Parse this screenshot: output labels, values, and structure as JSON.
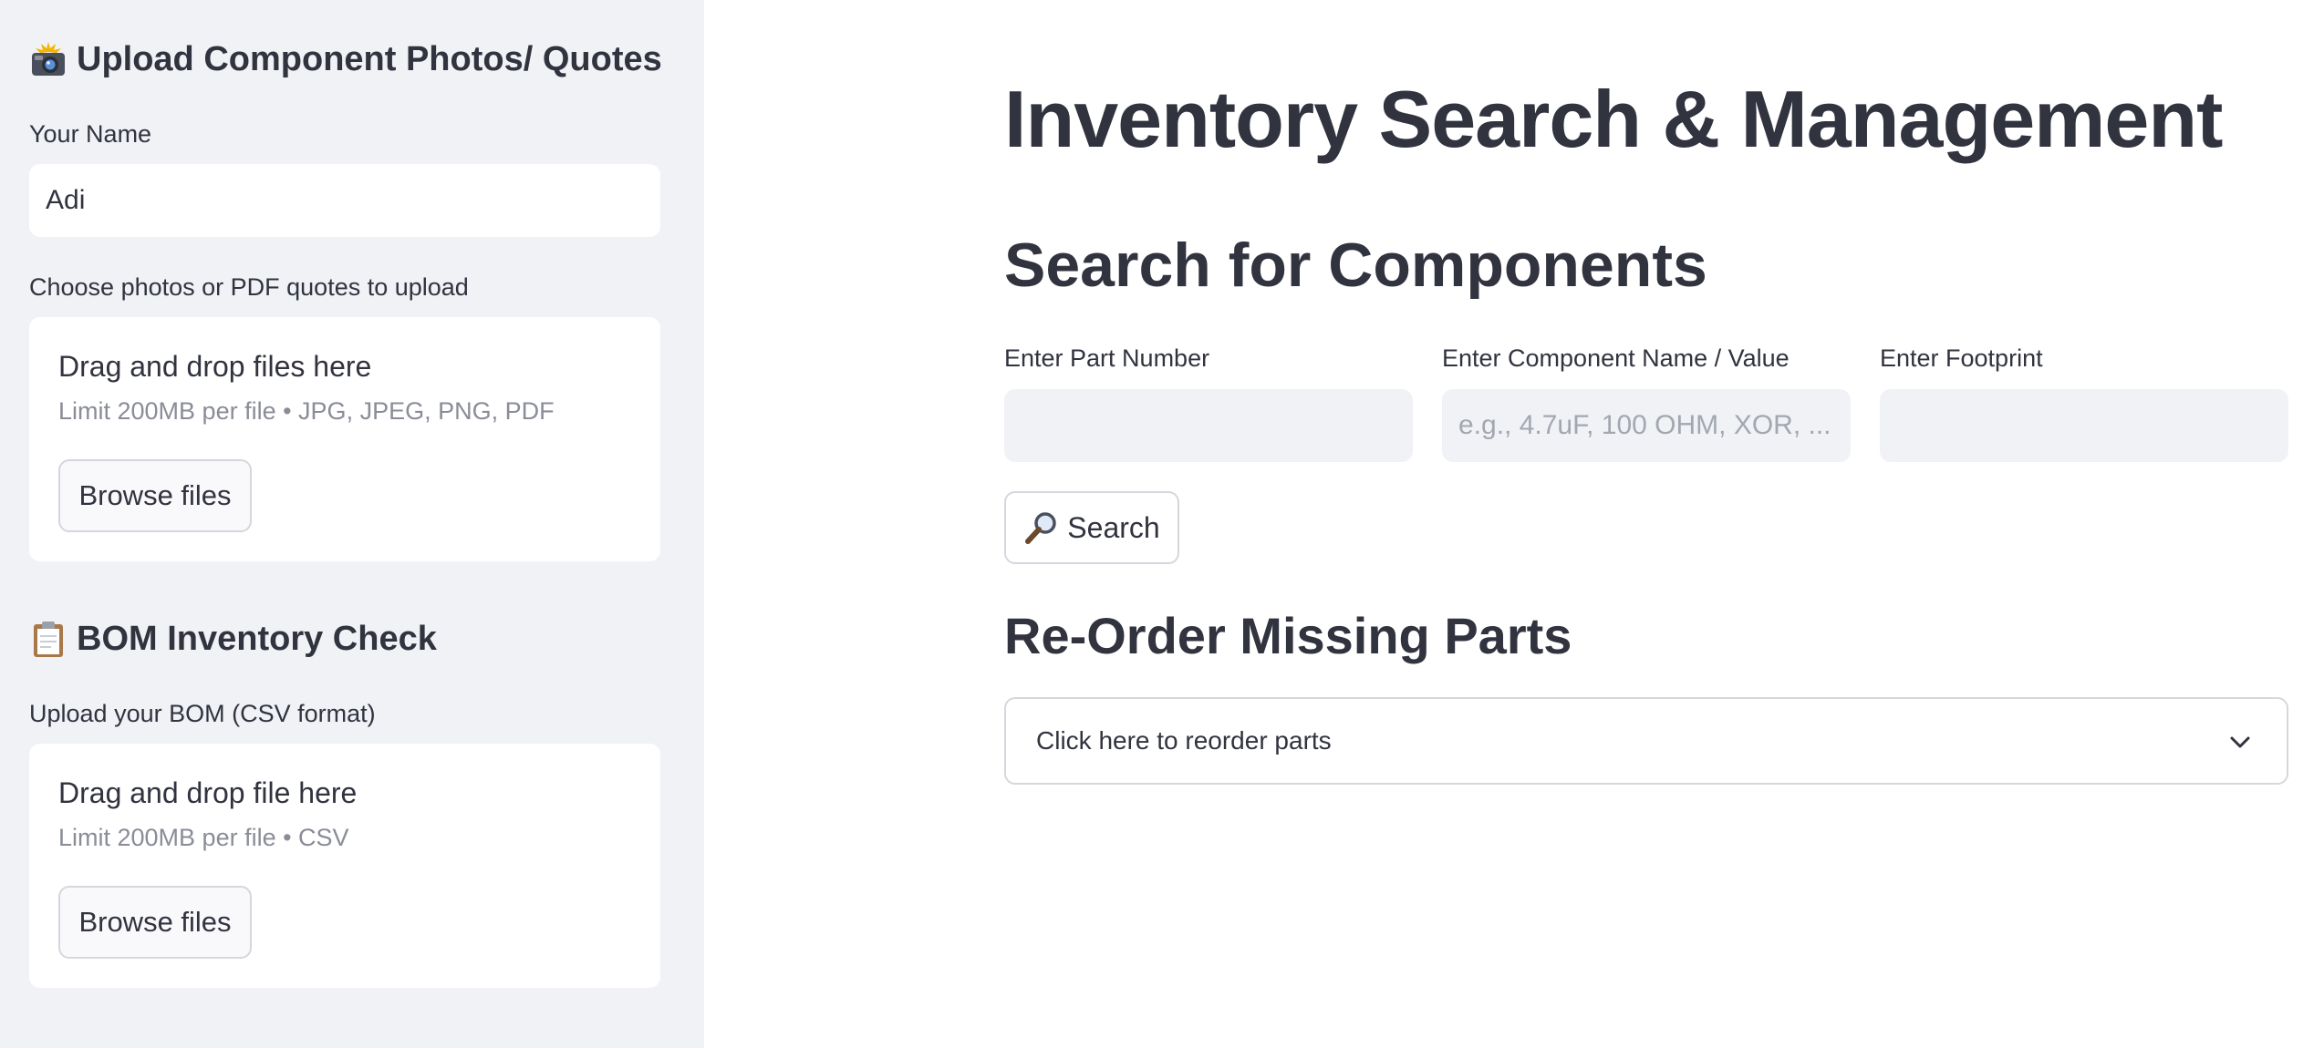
{
  "sidebar": {
    "upload_photos": {
      "icon": "camera-flash-icon",
      "header": "Upload Component Photos/ Quotes",
      "name_label": "Your Name",
      "name_value": "Adi",
      "files_label": "Choose photos or PDF quotes to upload",
      "dropzone_title": "Drag and drop files here",
      "dropzone_limit": "Limit 200MB per file • JPG, JPEG, PNG, PDF",
      "browse_label": "Browse files"
    },
    "bom_check": {
      "icon": "clipboard-icon",
      "header": "BOM Inventory Check",
      "upload_label": "Upload your BOM (CSV format)",
      "dropzone_title": "Drag and drop file here",
      "dropzone_limit": "Limit 200MB per file • CSV",
      "browse_label": "Browse files"
    }
  },
  "main": {
    "title": "Inventory Search & Management",
    "search_section": {
      "title": "Search for Components",
      "part_number": {
        "label": "Enter Part Number",
        "value": "",
        "placeholder": ""
      },
      "component_name": {
        "label": "Enter Component Name / Value",
        "value": "",
        "placeholder": "e.g., 4.7uF, 100 OHM, XOR, ..."
      },
      "footprint": {
        "label": "Enter Footprint",
        "value": "",
        "placeholder": ""
      },
      "search_button": {
        "icon": "magnifier-icon",
        "label": "Search"
      }
    },
    "reorder_section": {
      "title": "Re-Order Missing Parts",
      "expander_label": "Click here to reorder parts",
      "expander_icon": "chevron-down-icon"
    }
  },
  "colors": {
    "sidebar_bg": "#f0f2f6",
    "text": "#31333f",
    "muted_text": "#8a8d97",
    "placeholder": "#a3a7b0",
    "border": "#d5d7dd",
    "input_bg": "#f0f2f6"
  }
}
